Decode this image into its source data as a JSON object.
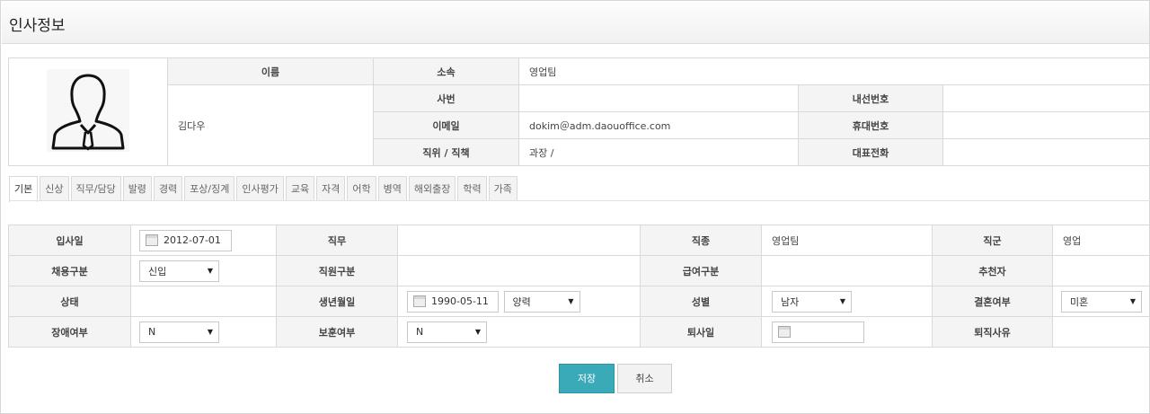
{
  "page": {
    "title": "인사정보"
  },
  "profile": {
    "name": "김다우",
    "labels": {
      "name": "이름",
      "dept": "소속",
      "emp_no": "사번",
      "email": "이메일",
      "position": "직위 / 직책",
      "ext": "내선번호",
      "mobile": "휴대번호",
      "main_phone": "대표전화"
    },
    "values": {
      "dept": "영업팀",
      "emp_no": "",
      "email": "dokim＠adm.daouoffice.com",
      "position": "과장 /",
      "ext": "",
      "mobile": "",
      "main_phone": ""
    }
  },
  "tabs": [
    "기본",
    "신상",
    "직무/담당",
    "발령",
    "경력",
    "포상/징계",
    "인사평가",
    "교육",
    "자격",
    "어학",
    "병역",
    "해외출장",
    "학력",
    "가족"
  ],
  "basic": {
    "labels": {
      "join_date": "입사일",
      "duty": "직무",
      "job_type": "직종",
      "job_group": "직군",
      "hire_type": "채용구분",
      "staff_type": "직원구분",
      "pay_type": "급여구분",
      "recommender": "추천자",
      "status": "상태",
      "birthday": "생년월일",
      "gender": "성별",
      "married": "결혼여부",
      "disabled": "장애여부",
      "veteran": "보훈여부",
      "resign_date": "퇴사일",
      "resign_reason": "퇴직사유"
    },
    "values": {
      "join_date": "2012-07-01",
      "duty": "",
      "job_type": "영업팀",
      "job_group": "영업",
      "hire_type": "신입",
      "staff_type": "",
      "pay_type": "",
      "recommender": "",
      "status": "",
      "birthday": "1990-05-11",
      "calendar_type": "양력",
      "gender": "남자",
      "married": "미혼",
      "disabled": "N",
      "veteran": "N",
      "resign_date": "",
      "resign_reason": ""
    }
  },
  "buttons": {
    "save": "저장",
    "cancel": "취소"
  },
  "icons": {
    "select_arrow": "▼",
    "avatar": "user-silhouette-icon",
    "calendar": "calendar-icon"
  },
  "colors": {
    "save_button": "#3aa9b8",
    "header_cell": "#f4f4f4"
  }
}
